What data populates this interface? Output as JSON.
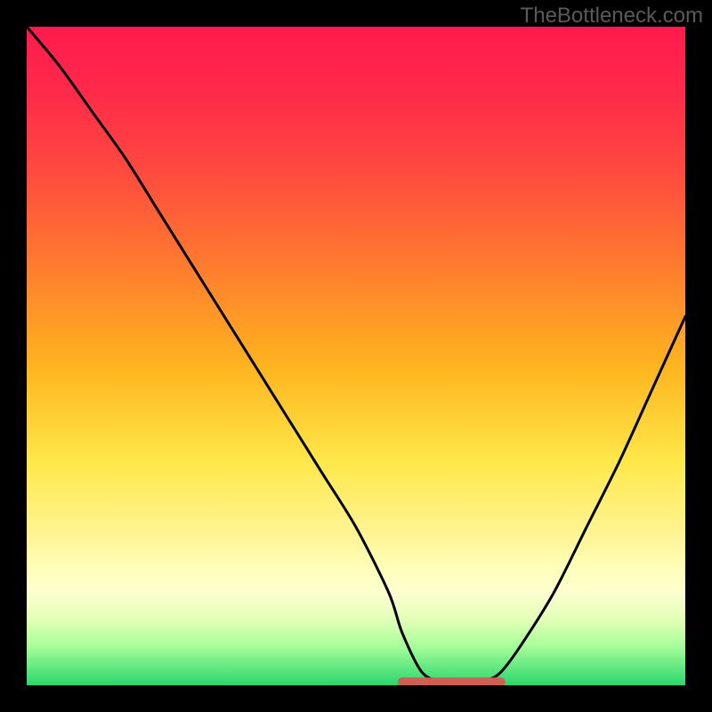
{
  "watermark": "TheBottleneck.com",
  "chart_data": {
    "type": "line",
    "title": "",
    "xlabel": "",
    "ylabel": "",
    "xlim": [
      0,
      100
    ],
    "ylim": [
      0,
      100
    ],
    "grid": false,
    "legend": false,
    "annotations": [
      {
        "text": "TheBottleneck.com",
        "pos": "top-right"
      }
    ],
    "series": [
      {
        "name": "bottleneck-curve",
        "x": [
          0,
          5,
          10,
          15,
          20,
          25,
          30,
          35,
          40,
          45,
          50,
          55,
          57,
          60,
          63,
          65,
          68,
          70,
          72,
          75,
          80,
          85,
          90,
          95,
          100
        ],
        "y": [
          100,
          94,
          87,
          80,
          72,
          64,
          56,
          48,
          40,
          32,
          24,
          14,
          8,
          2,
          0.5,
          0.5,
          0.5,
          0.8,
          2,
          6,
          14,
          24,
          34,
          45,
          56
        ]
      }
    ],
    "valley_marker": {
      "name": "optimal-range",
      "color": "#cc6052",
      "x_range": [
        57,
        72
      ],
      "y": 0.5
    },
    "background_gradient": {
      "top": "#ff1a4d",
      "mid": "#ffe84a",
      "bottom": "#2bd56c"
    }
  }
}
